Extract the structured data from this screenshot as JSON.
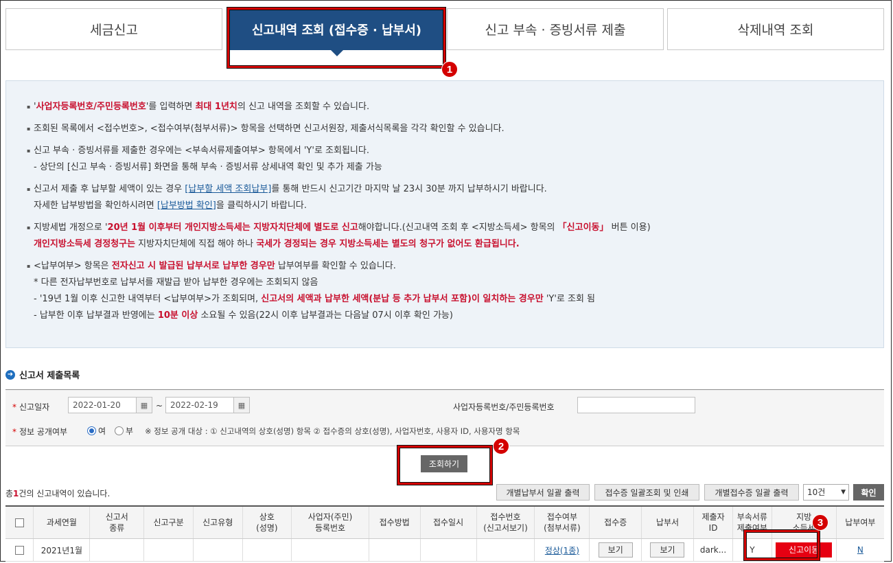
{
  "tabs": [
    {
      "label": "세금신고"
    },
    {
      "label": "신고내역 조회 (접수증 · 납부서)"
    },
    {
      "label": "신고 부속 · 증빙서류 제출"
    },
    {
      "label": "삭제내역 조회"
    }
  ],
  "callouts": [
    "1",
    "2",
    "3"
  ],
  "info": {
    "l1": {
      "a": "'",
      "b": "사업자등록번호/주민등록번호",
      "c": "'를 입력하면 ",
      "d": "최대 1년치",
      "e": "의 신고 내역을 조회할 수 있습니다."
    },
    "l2": "조회된 목록에서 <접수번호>, <접수여부(첨부서류)> 항목을 선택하면 신고서원장, 제출서식목록을 각각 확인할 수 있습니다.",
    "l3a": "신고 부속 · 증빙서류를 제출한 경우에는 <부속서류제출여부> 항목에서 'Y'로 조회됩니다.",
    "l3b": "- 상단의 [신고 부속 · 증빙서류] 화면을 통해 부속 · 증빙서류 상세내역 확인 및 추가 제출 가능",
    "l4a": {
      "a": "신고서 제출 후 납부할 세액이 있는 경우 ",
      "link": "[납부할 세액 조회납부]",
      "c": "를 통해 반드시 신고기간 마지막 날 23시 30분 까지 납부하시기 바랍니다."
    },
    "l4b": {
      "a": "자세한 납부방법을 확인하시려면 ",
      "link": "[납부방법 확인]",
      "c": "을 클릭하시기 바랍니다."
    },
    "l5a": {
      "a": "지방세법 개정으로 '",
      "b": "20년 1월 이후부터 개인지방소득세는 지방자치단체에 별도로 신고",
      "c": "해야합니다.(신고내역 조회 후 <지방소득세> 항목의 ",
      "d": "「신고이동」",
      "e": " 버튼 이용)"
    },
    "l5b": {
      "a": "개인지방소득세 경정청구는",
      "b": " 지방자치단체에 직접 해야 하나 ",
      "c": "국세가 경정되는 경우 지방소득세는 별도의 청구가 없어도 환급됩니다."
    },
    "l6a": {
      "a": "<납부여부> 항목은 ",
      "b": "전자신고 시 발급된 납부서로 납부한 경우만",
      "c": " 납부여부를 확인할 수 있습니다."
    },
    "l6b": " * 다른 전자납부번호로 납부서를 재발급 받아 납부한 경우에는 조회되지 않음",
    "l6c": {
      "a": "- '19년 1월 이후 신고한 내역부터 <납부여부>가 조회되며, ",
      "b": "신고서의 세액과 납부한 세액(분납 등 추가 납부서 포함)이 일치하는 경우만",
      "c": " 'Y'로 조회 됨"
    },
    "l6d": {
      "a": "- 납부한 이후 납부결과 반영에는 ",
      "b": "10분 이상",
      "c": " 소요될 수 있음(22시 이후 납부결과는 다음날 07시 이후 확인 가능)"
    }
  },
  "section": {
    "title": "신고서 제출목록"
  },
  "search": {
    "date_label": "신고일자",
    "date_from": "2022-01-20",
    "tilde": "~",
    "date_to": "2022-02-19",
    "bizno_label": "사업자등록번호/주민등록번호",
    "bizno_value": "",
    "public_label": "정보 공개여부",
    "yes": "여",
    "no": "부",
    "note": "※ 정보 공개 대상 : ① 신고내역의 상호(성명) 항목 ② 접수증의 상호(성명), 사업자번호, 사용자 ID, 사용자명 항목",
    "search_button": "조회하기"
  },
  "result": {
    "prefix": "총",
    "count": "1",
    "suffix": "건의 신고내역이 있습니다."
  },
  "toolbar": {
    "btn1": "개별납부서 일괄 출력",
    "btn2": "접수증 일괄조회 및 인쇄",
    "btn3": "개별접수증 일괄 출력",
    "page_size": "10건",
    "confirm": "확인"
  },
  "table": {
    "headers": [
      "과세연월",
      "신고서\n종류",
      "신고구분",
      "신고유형",
      "상호\n(성명)",
      "사업자(주민)\n등록번호",
      "접수방법",
      "접수일시",
      "접수번호\n(신고서보기)",
      "접수여부\n(첨부서류)",
      "접수증",
      "납부서",
      "제출자\nID",
      "부속서류\n제출여부",
      "지방\n소득세",
      "납부여부"
    ],
    "row": {
      "period": "2021년1월",
      "status_link": "정상(1종)",
      "receipt_btn": "보기",
      "payment_btn": "보기",
      "submitter": "dark...",
      "attach": "Y",
      "local_btn": "신고이동",
      "paid": "N"
    }
  }
}
